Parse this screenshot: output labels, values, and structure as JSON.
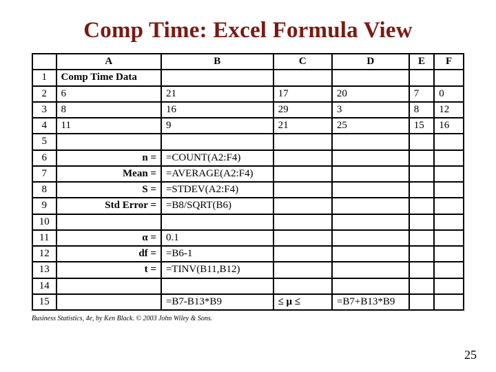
{
  "title": "Comp Time: Excel Formula View",
  "columns": {
    "corner": "",
    "A": "A",
    "B": "B",
    "C": "C",
    "D": "D",
    "E": "E",
    "F": "F"
  },
  "rows": {
    "r1": {
      "num": "1",
      "A": "Comp Time Data",
      "B": "",
      "C": "",
      "D": "",
      "E": "",
      "F": ""
    },
    "r2": {
      "num": "2",
      "A": "6",
      "B": "21",
      "C": "17",
      "D": "20",
      "E": "7",
      "F": "0"
    },
    "r3": {
      "num": "3",
      "A": "8",
      "B": "16",
      "C": "29",
      "D": "3",
      "E": "8",
      "F": "12"
    },
    "r4": {
      "num": "4",
      "A": "11",
      "B": "9",
      "C": "21",
      "D": "25",
      "E": "15",
      "F": "16"
    },
    "r5": {
      "num": "5",
      "A": "",
      "B": "",
      "C": "",
      "D": "",
      "E": "",
      "F": ""
    },
    "r6": {
      "num": "6",
      "A": "n =",
      "B": "=COUNT(A2:F4)",
      "C": "",
      "D": "",
      "E": "",
      "F": ""
    },
    "r7": {
      "num": "7",
      "A": "Mean =",
      "B": "=AVERAGE(A2:F4)",
      "C": "",
      "D": "",
      "E": "",
      "F": ""
    },
    "r8": {
      "num": "8",
      "A": "S =",
      "B": "=STDEV(A2:F4)",
      "C": "",
      "D": "",
      "E": "",
      "F": ""
    },
    "r9": {
      "num": "9",
      "A": "Std Error =",
      "B": "=B8/SQRT(B6)",
      "C": "",
      "D": "",
      "E": "",
      "F": ""
    },
    "r10": {
      "num": "10",
      "A": "",
      "B": "",
      "C": "",
      "D": "",
      "E": "",
      "F": ""
    },
    "r11": {
      "num": "11",
      "A": "α =",
      "B": "0.1",
      "C": "",
      "D": "",
      "E": "",
      "F": ""
    },
    "r12": {
      "num": "12",
      "A": "df =",
      "B": "=B6-1",
      "C": "",
      "D": "",
      "E": "",
      "F": ""
    },
    "r13": {
      "num": "13",
      "A": "t =",
      "B": "=TINV(B11,B12)",
      "C": "",
      "D": "",
      "E": "",
      "F": ""
    },
    "r14": {
      "num": "14",
      "A": "",
      "B": "",
      "C": "",
      "D": "",
      "E": "",
      "F": ""
    },
    "r15": {
      "num": "15",
      "A": "",
      "B": "=B7-B13*B9",
      "C": "≤ μ ≤",
      "D": "=B7+B13*B9",
      "E": "",
      "F": ""
    }
  },
  "footnote": "Business Statistics, 4e, by Ken Black. © 2003 John Wiley & Sons.",
  "page_number": "25"
}
